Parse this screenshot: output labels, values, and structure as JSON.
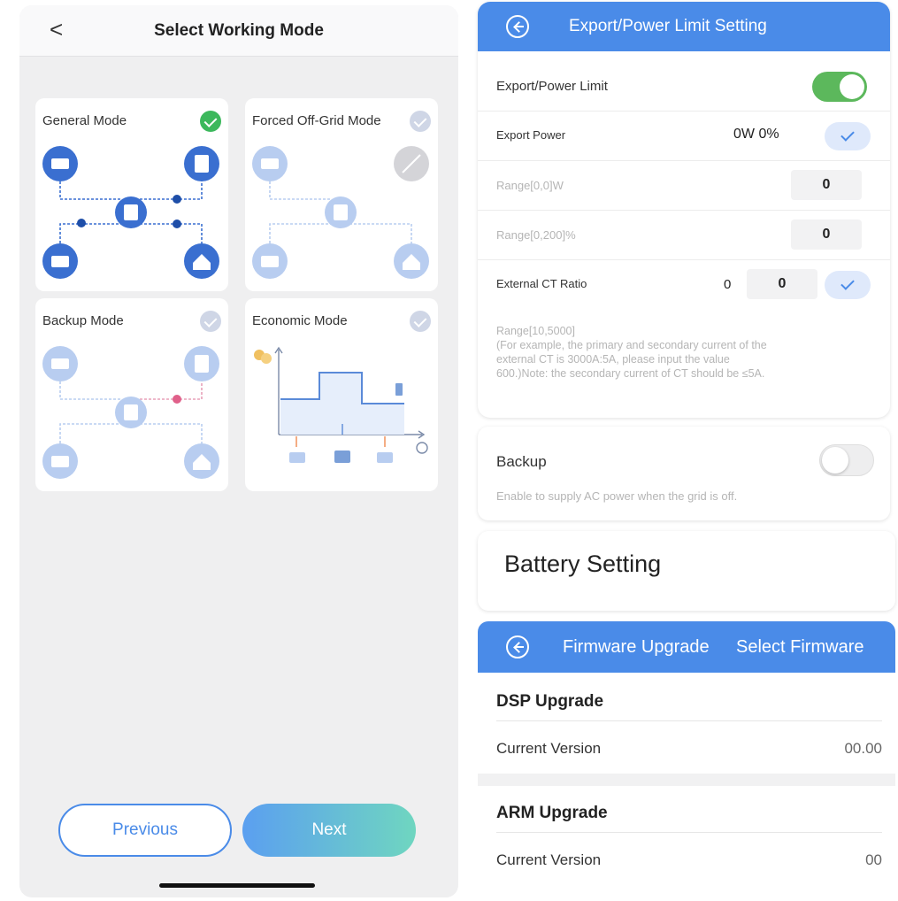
{
  "left": {
    "title": "Select Working Mode",
    "back_icon": "chevron-left-icon",
    "modes": [
      {
        "title": "General Mode",
        "selected": true
      },
      {
        "title": "Forced Off-Grid Mode",
        "selected": false
      },
      {
        "title": "Backup Mode",
        "selected": false
      },
      {
        "title": "Economic Mode",
        "selected": false
      }
    ],
    "previous_label": "Previous",
    "next_label": "Next",
    "colors": {
      "accent": "#4a8be8",
      "check": "#3cb85c",
      "next_gradient_end": "#6fd6c0"
    }
  },
  "export_limit": {
    "title": "Export/Power Limit Setting",
    "toggle_label": "Export/Power Limit",
    "toggle_on": true,
    "export_power_label": "Export Power",
    "export_power_value": "0W 0%",
    "range_w_label": "Range[0,0]W",
    "range_w_value": "0",
    "range_pct_label": "Range[0,200]%",
    "range_pct_value": "0",
    "ct_ratio_label": "External CT Ratio",
    "ct_ratio_current": "0",
    "ct_ratio_value": "0",
    "note_line1": "Range[10,5000]",
    "note_line2": "(For example, the primary and secondary current of the",
    "note_line3": "external CT is 3000A:5A, please input the value",
    "note_line4": "600.)Note: the secondary current of CT should be ≤5A."
  },
  "backup": {
    "label": "Backup",
    "toggle_on": false,
    "description": "Enable to supply AC power when the grid is off."
  },
  "battery": {
    "title": "Battery Setting"
  },
  "firmware": {
    "title": "Firmware Upgrade",
    "action": "Select Firmware",
    "dsp": {
      "title": "DSP Upgrade",
      "version_label": "Current Version",
      "version": "00.00"
    },
    "arm": {
      "title": "ARM Upgrade",
      "version_label": "Current Version",
      "version": "00"
    }
  }
}
